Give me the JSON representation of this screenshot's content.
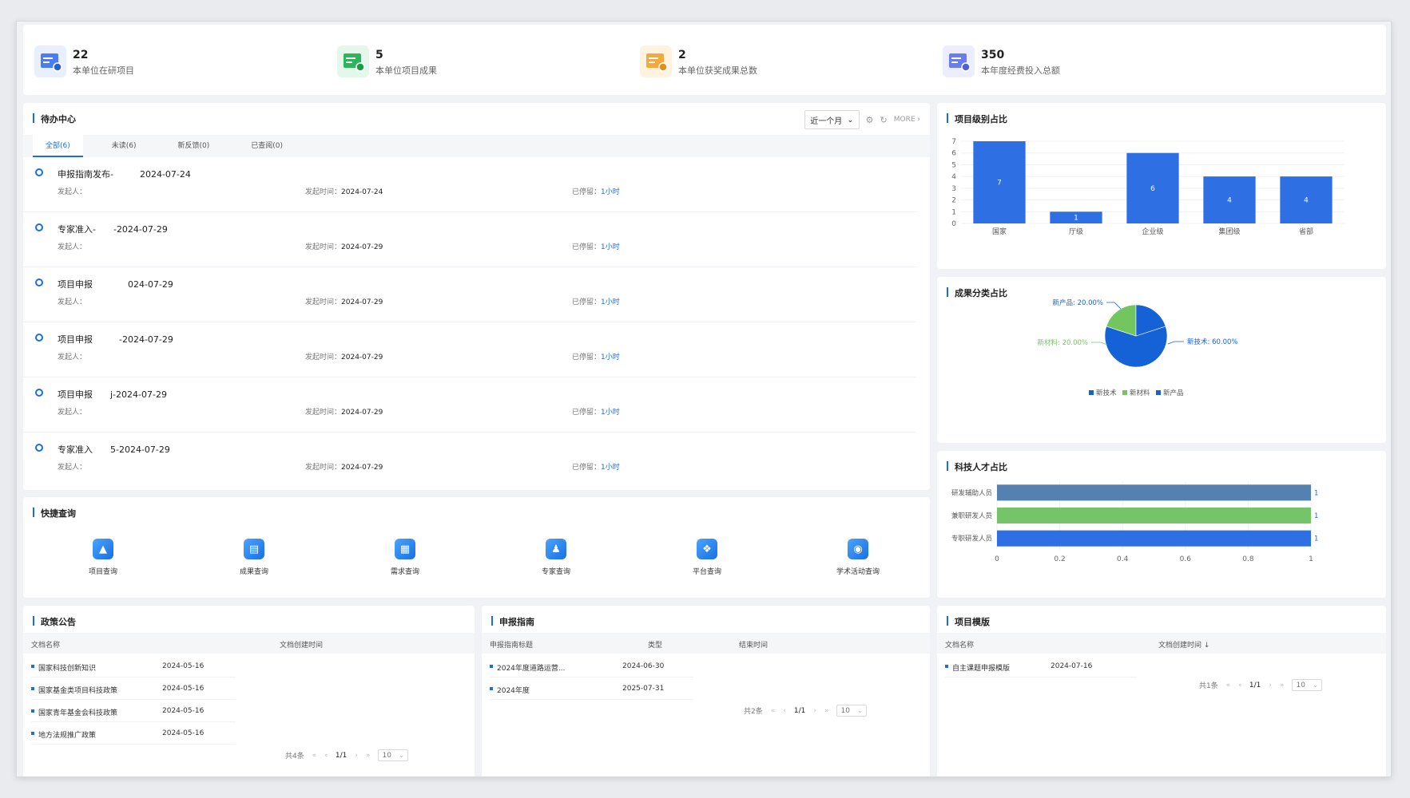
{
  "stats": [
    {
      "value": "22",
      "label": "本单位在研项目",
      "color": "#4a7df0",
      "icon": "project-icon"
    },
    {
      "value": "5",
      "label": "本单位项目成果",
      "color": "#2cb55a",
      "icon": "achievement-icon"
    },
    {
      "value": "2",
      "label": "本单位获奖成果总数",
      "color": "#f3a93c",
      "icon": "award-icon"
    },
    {
      "value": "350",
      "label": "本年度经费投入总额",
      "color": "#6b7cf0",
      "icon": "funding-icon"
    }
  ],
  "todo": {
    "title": "待办中心",
    "range": "近一个月",
    "more": "MORE",
    "tabs": [
      "全部(6)",
      "未读(6)",
      "新反馈(0)",
      "已查阅(0)"
    ],
    "sender_label": "发起人：",
    "time_label": "发起时间：",
    "stay_label": "已停留：",
    "items": [
      {
        "title": "申报指南发布-　　　2024-07-24",
        "time": "2024-07-24",
        "stay": "1小时"
      },
      {
        "title": "专家准入-　　-2024-07-29",
        "time": "2024-07-29",
        "stay": "1小时"
      },
      {
        "title": "项目申报　　　　024-07-29",
        "time": "2024-07-29",
        "stay": "1小时"
      },
      {
        "title": "项目申报　　　-2024-07-29",
        "time": "2024-07-29",
        "stay": "1小时"
      },
      {
        "title": "项目申报　　j-2024-07-29",
        "time": "2024-07-29",
        "stay": "1小时"
      },
      {
        "title": "专家准入　　5-2024-07-29",
        "time": "2024-07-29",
        "stay": "1小时"
      }
    ]
  },
  "quick": {
    "title": "快捷查询",
    "items": [
      {
        "label": "项目查询",
        "icon": "project-search-icon",
        "glyph": "▲"
      },
      {
        "label": "成果查询",
        "icon": "achievement-search-icon",
        "glyph": "▤"
      },
      {
        "label": "需求查询",
        "icon": "demand-search-icon",
        "glyph": "▦"
      },
      {
        "label": "专家查询",
        "icon": "expert-search-icon",
        "glyph": "♟"
      },
      {
        "label": "平台查询",
        "icon": "platform-search-icon",
        "glyph": "❖"
      },
      {
        "label": "学术活动查询",
        "icon": "academic-search-icon",
        "glyph": "◉"
      }
    ]
  },
  "level_chart": {
    "title": "项目级别占比",
    "chart_data": {
      "type": "bar",
      "categories": [
        "国家",
        "厅级",
        "企业级",
        "集团级",
        "省部"
      ],
      "values": [
        7,
        1,
        6,
        4,
        4
      ],
      "ylim": [
        0,
        7
      ],
      "yticks": [
        0,
        1,
        2,
        3,
        4,
        5,
        6,
        7
      ],
      "color": "#2f6fe4"
    }
  },
  "achievement_chart": {
    "title": "成果分类占比",
    "chart_data": {
      "type": "pie",
      "labels": [
        "新技术",
        "新材料",
        "新产品"
      ],
      "values": [
        60,
        20,
        20
      ],
      "label_texts": [
        "新技术: 60.00%",
        "新材料: 20.00%",
        "新产品: 20.00%"
      ],
      "colors": [
        "#1562d6",
        "#73c65f",
        "#1562d6"
      ]
    }
  },
  "talent_chart": {
    "title": "科技人才占比",
    "chart_data": {
      "type": "bar",
      "orientation": "horizontal",
      "categories": [
        "研发辅助人员",
        "兼职研发人员",
        "专职研发人员"
      ],
      "values": [
        1,
        1,
        1
      ],
      "xlim": [
        0,
        1
      ],
      "xticks": [
        "0",
        "0.2",
        "0.4",
        "0.6",
        "0.8",
        "1"
      ],
      "colors": [
        "#5581b0",
        "#76c46a",
        "#2f6fe4"
      ]
    }
  },
  "policy": {
    "title": "政策公告",
    "col1": "文档名称",
    "col2": "文档创建时间",
    "rows": [
      {
        "name": "国家科技创新知识",
        "date": "2024-05-16"
      },
      {
        "name": "国家基金类项目科技政策",
        "date": "2024-05-16"
      },
      {
        "name": "国家青年基金会科技政策",
        "date": "2024-05-16"
      },
      {
        "name": "地方法规推广政策",
        "date": "2024-05-16"
      }
    ],
    "total": "共4条",
    "page": "1/1",
    "size": "10"
  },
  "guide": {
    "title": "申报指南",
    "col1": "申报指南标题",
    "col2": "类型",
    "col3": "结束时间",
    "rows": [
      {
        "name": "2024年度道路运营...",
        "date": "2024-06-30"
      },
      {
        "name": "2024年度",
        "date": "2025-07-31"
      }
    ],
    "total": "共2条",
    "page": "1/1",
    "size": "10"
  },
  "template": {
    "title": "项目模版",
    "col1": "文档名称",
    "col2": "文档创建时间 ↓",
    "rows": [
      {
        "name": "自主课题申报模版",
        "date": "2024-07-16"
      }
    ],
    "total": "共1条",
    "page": "1/1",
    "size": "10"
  }
}
